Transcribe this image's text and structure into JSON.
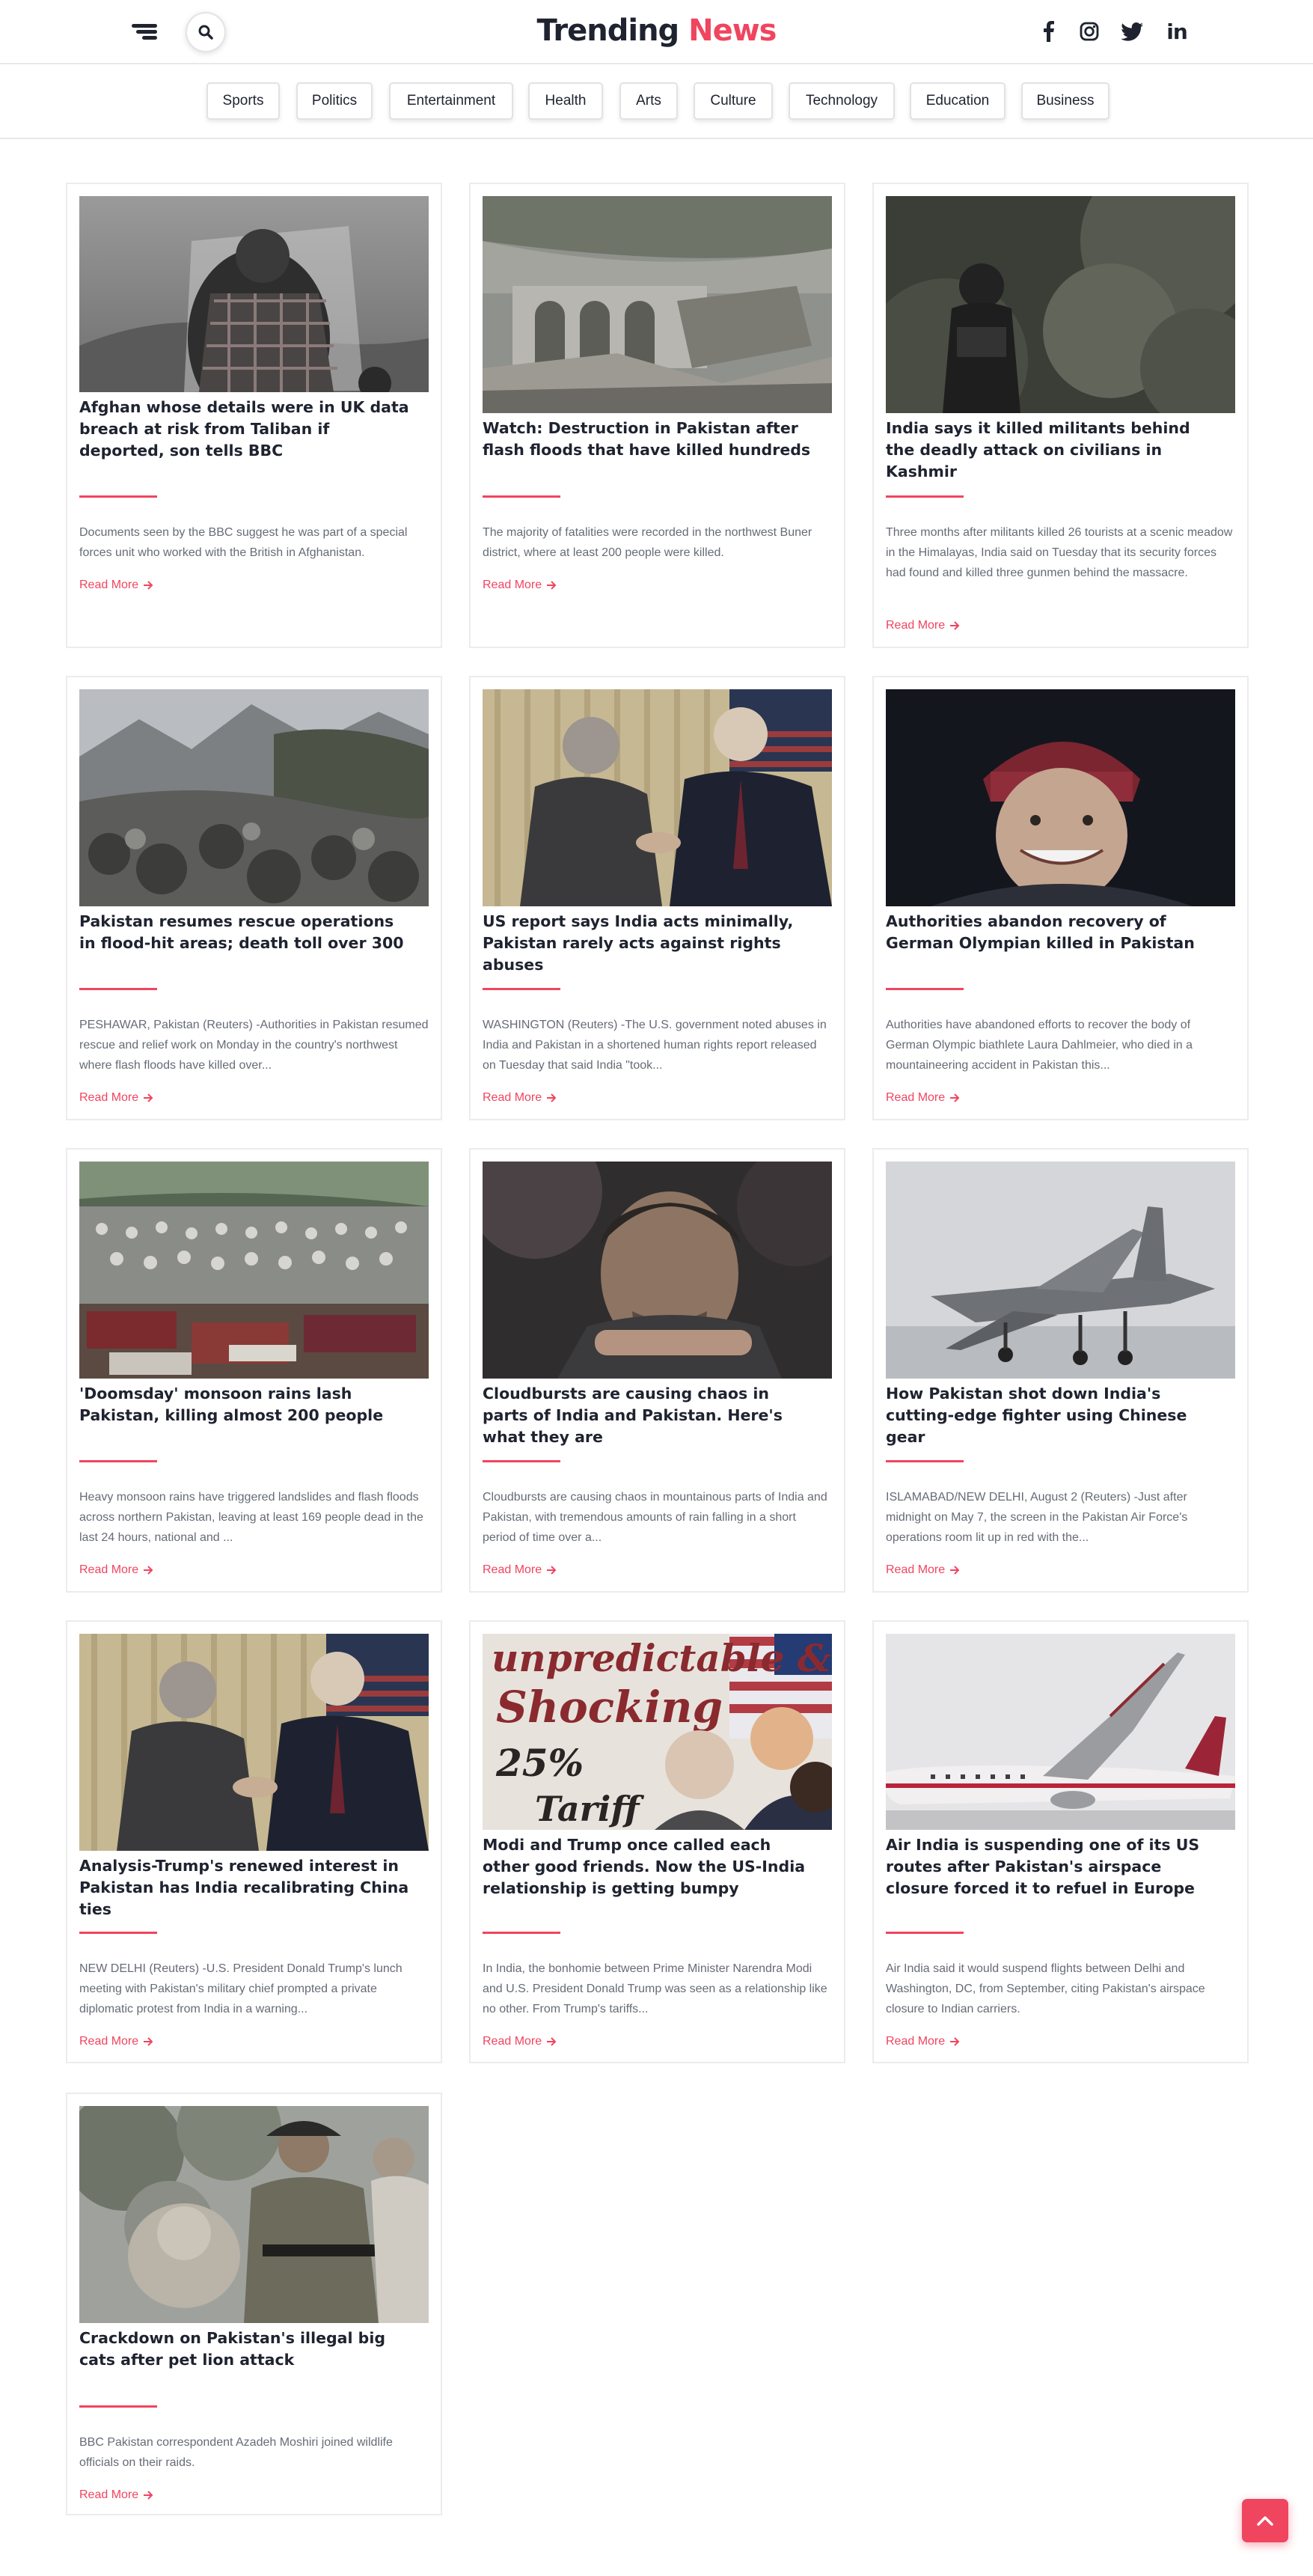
{
  "header": {
    "brand_primary": "Trending",
    "brand_accent": "News",
    "accent_color": "#f0455f",
    "icons": [
      "menu-icon",
      "search-icon",
      "facebook-icon",
      "instagram-icon",
      "twitter-icon",
      "linkedin-icon"
    ],
    "linkedin_glyph": "in"
  },
  "categories": [
    "Sports",
    "Politics",
    "Entertainment",
    "Health",
    "Arts",
    "Culture",
    "Technology",
    "Education",
    "Business"
  ],
  "read_more_label": "Read More",
  "articles": [
    {
      "title": "Afghan whose details were in UK data breach at risk from Taliban if deported, son tells BBC",
      "excerpt": "Documents seen by the BBC suggest he was part of a special forces unit who worked with the British in Afghanistan."
    },
    {
      "title": "Watch: Destruction in Pakistan after flash floods that have killed hundreds",
      "excerpt": "The majority of fatalities were recorded in the northwest Buner district, where at least 200 people were killed."
    },
    {
      "title": "India says it killed militants behind the deadly attack on civilians in Kashmir",
      "excerpt": "Three months after militants killed 26 tourists at a scenic meadow in the Himalayas, India said on Tuesday that its security forces had found and killed three gunmen behind the massacre."
    },
    {
      "title": "Pakistan resumes rescue operations in flood-hit areas; death toll over 300",
      "excerpt": "PESHAWAR, Pakistan (Reuters) -Authorities in Pakistan resumed rescue and relief work on Monday in the country's northwest where flash floods have killed over..."
    },
    {
      "title": "US report says India acts minimally, Pakistan rarely acts against rights abuses",
      "excerpt": "WASHINGTON (Reuters) -The U.S. government noted abuses in India and Pakistan in a shortened human rights report released on Tuesday that said India \"took..."
    },
    {
      "title": "Authorities abandon recovery of German Olympian killed in Pakistan",
      "excerpt": "Authorities have abandoned efforts to recover the body of German Olympic biathlete Laura Dahlmeier, who died in a mountaineering accident in Pakistan this..."
    },
    {
      "title": "'Doomsday' monsoon rains lash Pakistan, killing almost 200 people",
      "excerpt": "Heavy monsoon rains have triggered landslides and flash floods across northern Pakistan, leaving at least 169 people dead in the last 24 hours, national and ..."
    },
    {
      "title": "Cloudbursts are causing chaos in parts of India and Pakistan. Here's what they are",
      "excerpt": "Cloudbursts are causing chaos in mountainous parts of India and Pakistan, with tremendous amounts of rain falling in a short period of time over a..."
    },
    {
      "title": "How Pakistan shot down India's cutting-edge fighter using Chinese gear",
      "excerpt": "ISLAMABAD/NEW DELHI, August 2 (Reuters) -Just after midnight on May 7, the screen in the Pakistan Air Force's operations room lit up in red with the..."
    },
    {
      "title": "Analysis-Trump's renewed interest in Pakistan has India recalibrating China ties",
      "excerpt": "NEW DELHI (Reuters) -U.S. President Donald Trump's lunch meeting with Pakistan's military chief prompted a private diplomatic protest from India in a warning..."
    },
    {
      "title": "Modi and Trump once called each other good friends. Now the US-India relationship is getting bumpy",
      "excerpt": "In India, the bonhomie between Prime Minister Narendra Modi and U.S. President Donald Trump was seen as a relationship like no other. From Trump's tariffs...",
      "image_text": [
        "unpredictable &",
        "Shocking",
        "25%",
        "Tariff"
      ]
    },
    {
      "title": "Air India is suspending one of its US routes after Pakistan's airspace closure forced it to refuel in Europe",
      "excerpt": "Air India said it would suspend flights between Delhi and Washington, DC, from September, citing Pakistan's airspace closure to Indian carriers."
    },
    {
      "title": "Crackdown on Pakistan's illegal big cats after pet lion attack",
      "excerpt": "BBC Pakistan correspondent Azadeh Moshiri joined wildlife officials on their raids."
    }
  ]
}
